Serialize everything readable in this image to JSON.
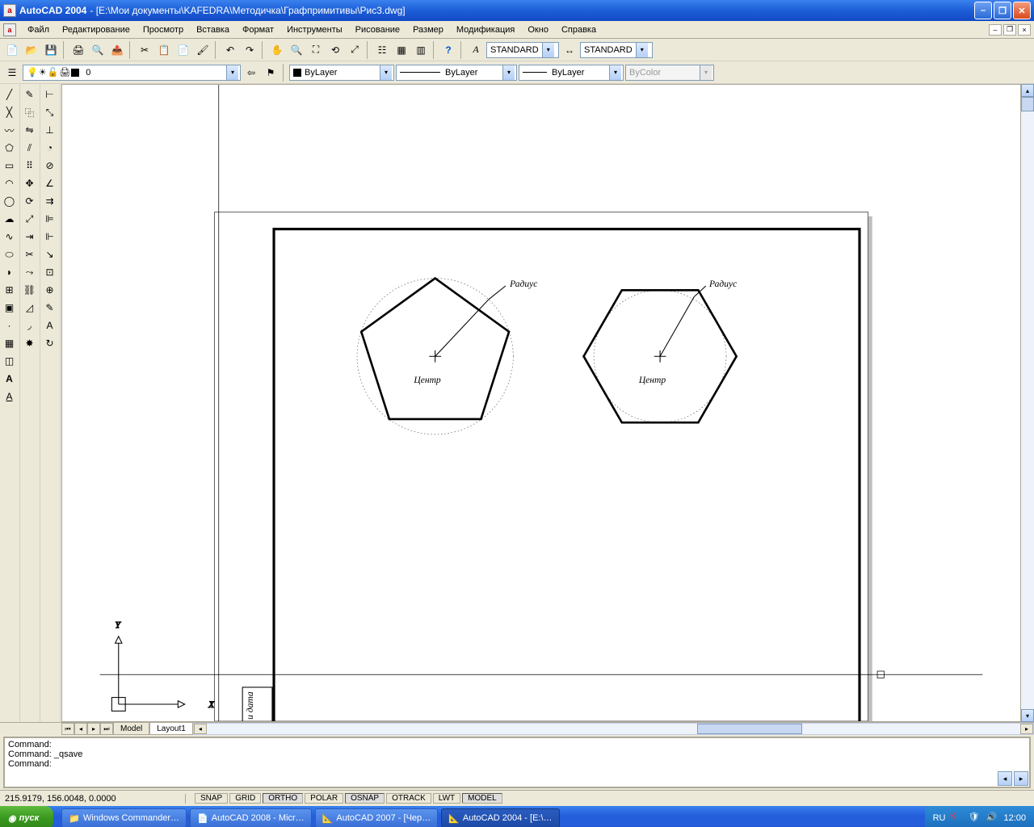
{
  "title": {
    "app": "AutoCAD 2004",
    "path": "- [E:\\Мои документы\\KAFEDRA\\Методичка\\Графпримитивы\\Рис3.dwg]"
  },
  "menu": [
    "Файл",
    "Редактирование",
    "Просмотр",
    "Вставка",
    "Формат",
    "Инструменты",
    "Рисование",
    "Размер",
    "Модификация",
    "Окно",
    "Справка"
  ],
  "style_row": {
    "text_style": "STANDARD",
    "dim_style": "STANDARD"
  },
  "layer_row": {
    "current_layer": "0",
    "color_control": "ByLayer",
    "linetype_control": "ByLayer",
    "lineweight_control": "ByLayer",
    "plotstyle_control": "ByColor"
  },
  "drawing": {
    "label_radius": "Радиус",
    "label_center": "Центр"
  },
  "tabs": {
    "model": "Model",
    "layout1": "Layout1"
  },
  "command": {
    "line1": "Command:",
    "line2": "Command: _qsave",
    "line3": "Command:"
  },
  "status": {
    "coords": "215.9179, 156.0048, 0.0000",
    "buttons": [
      "SNAP",
      "GRID",
      "ORTHO",
      "POLAR",
      "OSNAP",
      "OTRACK",
      "LWT",
      "MODEL"
    ]
  },
  "taskbar": {
    "start": "пуск",
    "tasks": [
      "Windows Commander…",
      "AutoCAD 2008 - Micr…",
      "AutoCAD 2007 - [Чер…",
      "AutoCAD 2004 - [E:\\…"
    ],
    "lang": "RU",
    "clock": "12:00"
  }
}
